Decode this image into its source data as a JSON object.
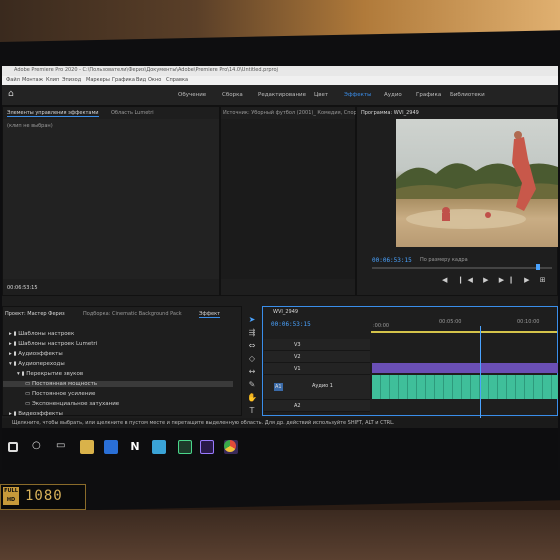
{
  "titlebar": {
    "text": "Adobe Premiere Pro 2020 - C:\\Пользователи\\Фериз\\Документы\\Adobe\\Premiere Pro\\14.0\\Untitled.prproj"
  },
  "menu": [
    "Файл",
    "Монтаж",
    "Клип",
    "Эпизод",
    "Маркеры",
    "Графика",
    "Вид",
    "Окно",
    "Справка"
  ],
  "workspaces": {
    "items": [
      "Обучение",
      "Сборка",
      "Редактирование",
      "Цвет",
      "Эффекты",
      "Аудио",
      "Графика",
      "Библиотеки"
    ],
    "active": "Эффекты"
  },
  "effect_controls": {
    "tab": "Элементы управления эффектами",
    "tab2": "Область Lumetri",
    "source": "Источник: Уборный футбол (2001)_ Комедия, Спорт, Боевик_ Full HD.mp4",
    "no_clip": "(клип не выбран)",
    "timecode": "00:06:53:15"
  },
  "program": {
    "tab": "Программа: WVI_2949",
    "timecode": "00:06:53:15",
    "fit": "По размеру кадра"
  },
  "project": {
    "tab": "Проект: Мастер Фериз",
    "tab2": "Подборка: Cinematic Background Pack",
    "tab3": "Эффект",
    "tree": [
      {
        "label": "Шаблоны настроек",
        "indent": 0
      },
      {
        "label": "Шаблоны настроек Lumetri",
        "indent": 0
      },
      {
        "label": "Аудиоэффекты",
        "indent": 0
      },
      {
        "label": "Аудиопереходы",
        "indent": 0
      },
      {
        "label": "Перекрытие звуков",
        "indent": 1
      },
      {
        "label": "Постоянная мощность",
        "indent": 2,
        "selected": true
      },
      {
        "label": "Постоянное усиление",
        "indent": 2
      },
      {
        "label": "Экспоненциальное затухание",
        "indent": 2
      },
      {
        "label": "Видеоэффекты",
        "indent": 0
      }
    ]
  },
  "timeline": {
    "tab": "WVI_2949",
    "timecode": "00:06:53:15",
    "ruler": [
      ":00:00",
      "00:05:00",
      "00:10:00"
    ],
    "tracks": [
      {
        "name": "V3"
      },
      {
        "name": "V2"
      },
      {
        "name": "V1"
      },
      {
        "name": "A1",
        "label": "Аудио 1"
      },
      {
        "name": "A2"
      }
    ],
    "playhead_fraction": 0.58
  },
  "status": {
    "text": "Щелкните, чтобы выбрать, или щелкните в пустом месте и перетащите выделенную область. Для др. действий используйте SHIFT, ALT и CTRL."
  },
  "taskbar": {
    "icons": [
      "windows-icon",
      "search-icon",
      "taskview-icon",
      "explorer-icon",
      "store-icon",
      "netflix-icon",
      "mail-icon",
      "media-icon",
      "premiere-icon",
      "effects-icon",
      "chrome-icon"
    ]
  },
  "sticker": {
    "line1": "FULL",
    "line2": "HD",
    "res": "1080"
  },
  "colors": {
    "accent": "#3a8eea",
    "audio_clip": "#3fbf9a",
    "video_clip": "#6a4fb5"
  }
}
